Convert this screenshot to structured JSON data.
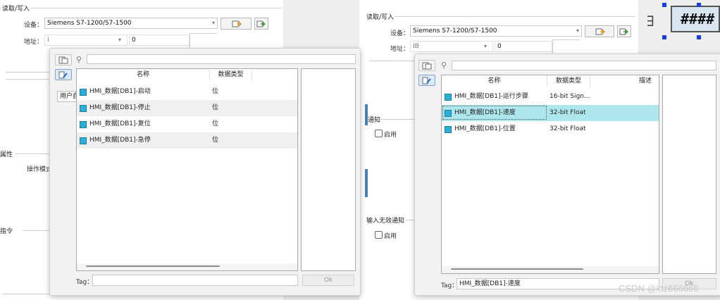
{
  "left": {
    "section_read_write": "读取/写入",
    "device_label": "设备：",
    "device_value": "Siemens S7-1200/S7-1500",
    "address_label": "地址：",
    "address_value": "I",
    "address_num": "0",
    "section_properties": "属性",
    "operation_mode": "操作模式",
    "section_instructions": "指令",
    "dialog": {
      "header_name": "名称",
      "header_type": "数据类型",
      "tooltip": "用户自定义标签",
      "rows": [
        {
          "name": "HMI_数据[DB1]-启动",
          "type": "位"
        },
        {
          "name": "HMI_数据[DB1]-停止",
          "type": "位"
        },
        {
          "name": "HMI_数据[DB1]-复位",
          "type": "位"
        },
        {
          "name": "HMI_数据[DB1]-急停",
          "type": "位"
        }
      ],
      "tag_label": "Tag：",
      "tag_value": "",
      "ok": "Ok"
    }
  },
  "right": {
    "section_read_write": "读取/写入",
    "device_label": "设备：",
    "device_value": "Siemens S7-1200/S7-1500",
    "address_label": "地址：",
    "address_value": "IB",
    "address_num": "0",
    "notify": "通知",
    "enable1": "启用",
    "input_invalid_notify": "输入无效通知",
    "enable2": "启用",
    "display_text": "####",
    "dialog": {
      "header_name": "名称",
      "header_type": "数据类型",
      "header_desc": "描述",
      "rows": [
        {
          "name": "HMI_数据[DB1]-运行步骤",
          "type": "16-bit Sign..."
        },
        {
          "name": "HMI_数据[DB1]-速度",
          "type": "32-bit Float"
        },
        {
          "name": "HMI_数据[DB1]-位置",
          "type": "32-bit Float"
        }
      ],
      "tag_label": "Tag：",
      "tag_value": "HMI_数据[DB1]-速度",
      "ok": "Ok"
    }
  },
  "watermark": "CSDN @ktz666666",
  "colors": {
    "selected_row": "#aee6ee",
    "tag_square": "#2ab0d8",
    "blue_handles": "#1a3fd9"
  }
}
